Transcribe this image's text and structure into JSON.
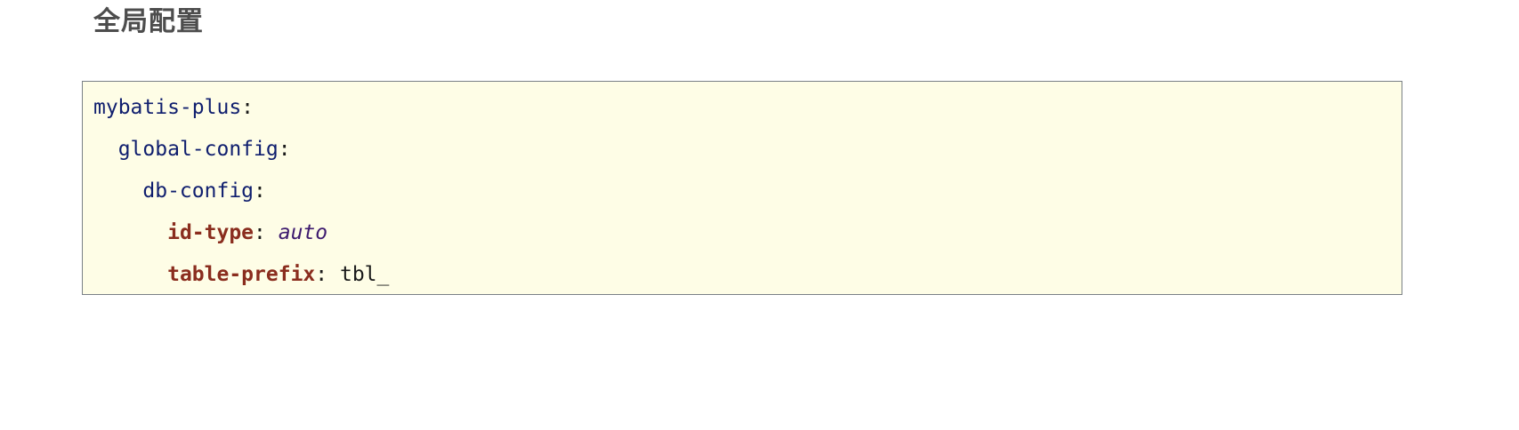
{
  "heading": "全局配置",
  "code": {
    "lines": [
      {
        "indent": "",
        "key": "mybatis-plus",
        "sep": ":",
        "value": ""
      },
      {
        "indent": "  ",
        "key": "global-config",
        "sep": ":",
        "value": ""
      },
      {
        "indent": "    ",
        "key": "db-config",
        "sep": ":",
        "value": ""
      },
      {
        "indent": "      ",
        "key": "id-type",
        "sep": ": ",
        "value": "auto"
      },
      {
        "indent": "      ",
        "key": "table-prefix",
        "sep": ": ",
        "value": "tbl_"
      }
    ]
  },
  "colors": {
    "background": "#fefde6",
    "border": "#7a8086",
    "plain_key": "#0f1e6e",
    "bold_key": "#8a2d1e",
    "italic_value": "#3d1a6e"
  }
}
